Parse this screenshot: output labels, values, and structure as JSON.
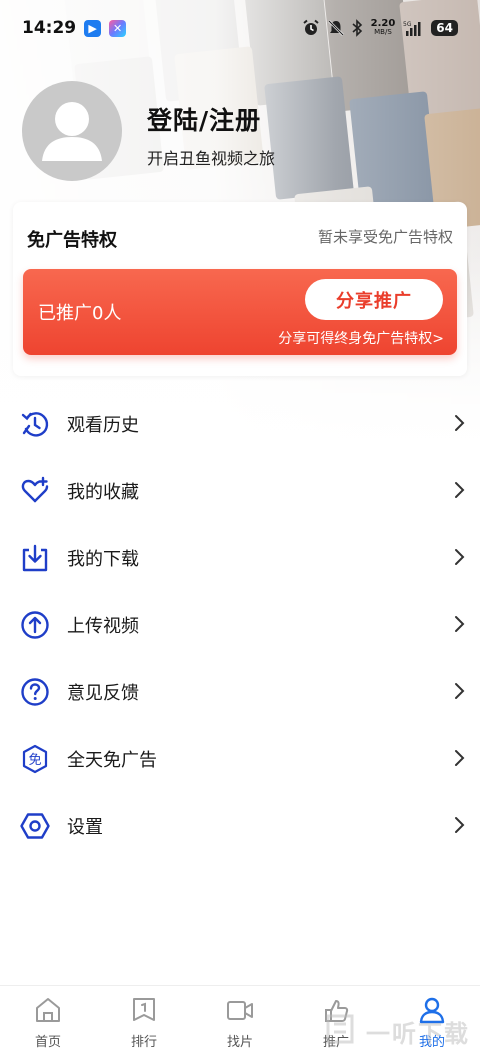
{
  "status": {
    "time": "14:29",
    "net_speed_value": "2.20",
    "net_speed_unit": "MB/S",
    "battery": "64"
  },
  "profile": {
    "title": "登陆/注册",
    "subtitle": "开启丑鱼视频之旅"
  },
  "adfree": {
    "title": "免广告特权",
    "status": "暂未享受免广告特权",
    "promoted_count": "已推广0人",
    "share_button": "分享推广",
    "note": "分享可得终身免广告特权>"
  },
  "menu": [
    {
      "label": "观看历史",
      "icon": "history-icon"
    },
    {
      "label": "我的收藏",
      "icon": "heart-plus-icon"
    },
    {
      "label": "我的下载",
      "icon": "download-icon"
    },
    {
      "label": "上传视频",
      "icon": "upload-icon"
    },
    {
      "label": "意见反馈",
      "icon": "question-icon"
    },
    {
      "label": "全天免广告",
      "icon": "adfree-badge-icon",
      "icon_text": "免"
    },
    {
      "label": "设置",
      "icon": "settings-hexagon-icon"
    }
  ],
  "nav": [
    {
      "label": "首页",
      "icon": "home-icon"
    },
    {
      "label": "排行",
      "icon": "ranking-icon"
    },
    {
      "label": "找片",
      "icon": "video-camera-icon"
    },
    {
      "label": "推广",
      "icon": "share-hand-icon"
    },
    {
      "label": "我的",
      "icon": "person-icon",
      "active": true
    }
  ],
  "colors": {
    "accent_blue": "#1e6fe8",
    "icon_blue": "#1f3ec8",
    "promo_red": "#ee4430",
    "share_text": "#ea3d2b"
  },
  "watermark": {
    "text": "一听下载"
  }
}
